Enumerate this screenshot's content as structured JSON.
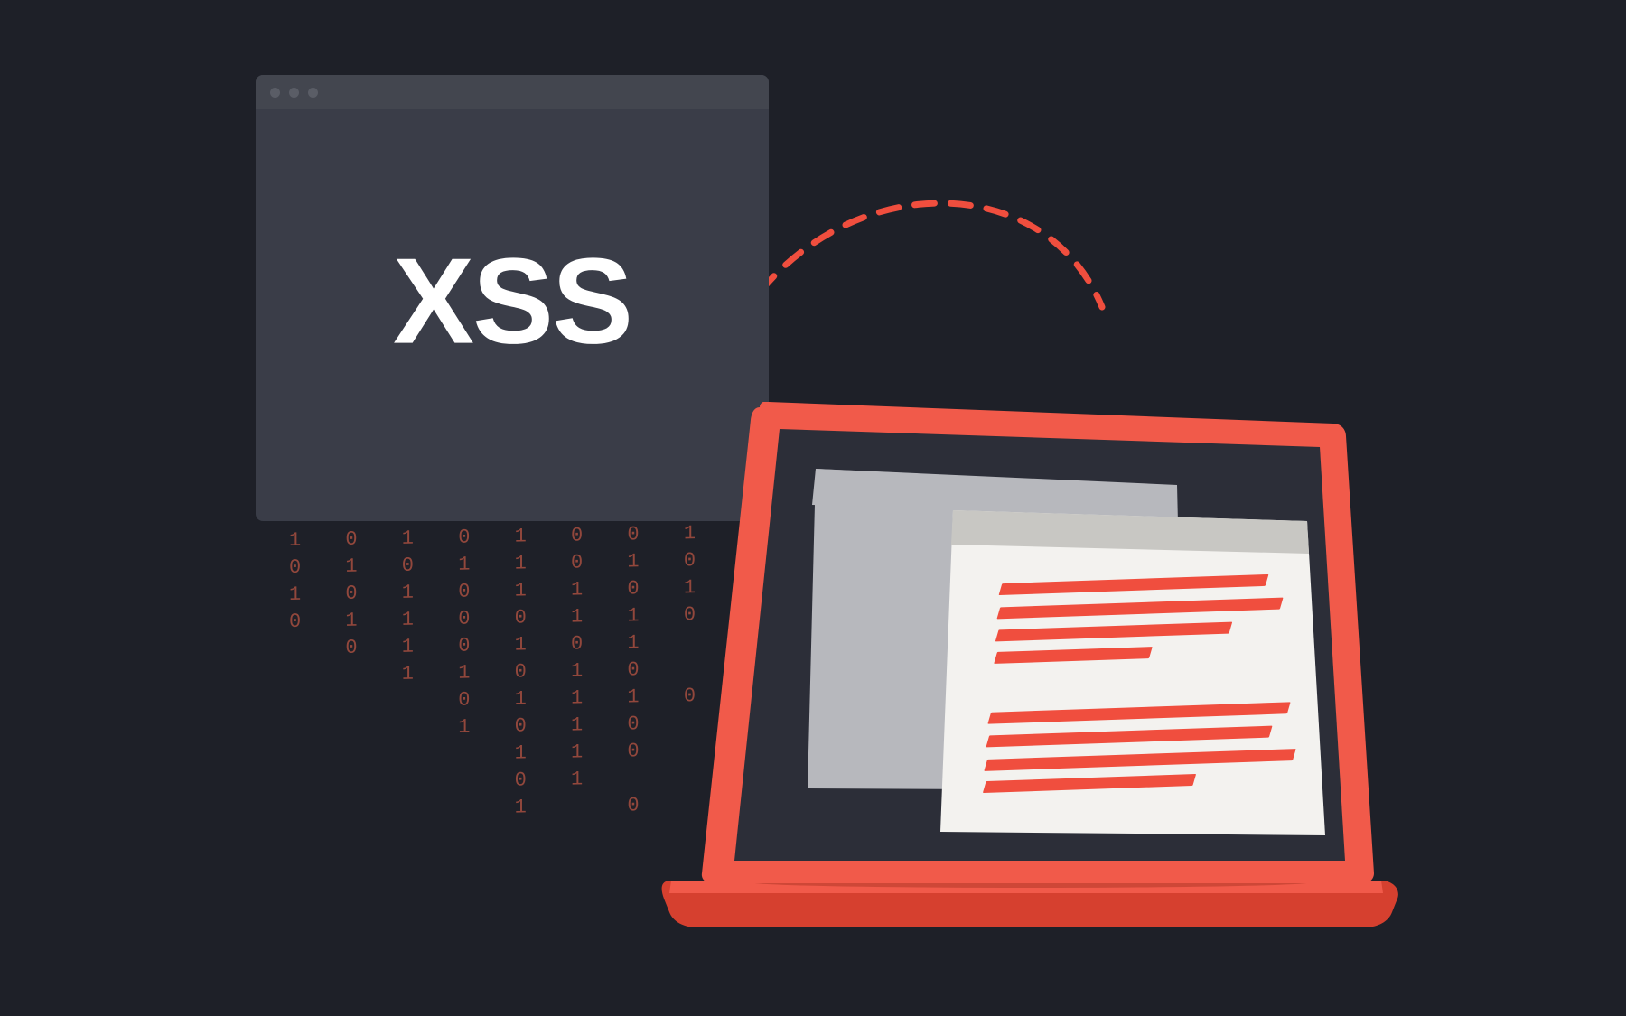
{
  "illustration": {
    "window_label": "XSS",
    "binary_rows": [
      "1 0 1 0 1 0 0 1 0",
      "0 1 0 1 1 0 1 0 1",
      "1 0 1 0 1 1 0 1 0",
      "0 1 1 0 0 1 1 0  ",
      "  0 1 0 1 0 1    ",
      "    1 1 0 1 0    ",
      "      0 1 1 1 0  ",
      "      1 0 1 0    ",
      "        1 1 0    ",
      "        0 1      ",
      "        1   0    "
    ],
    "colors": {
      "background": "#1e2028",
      "window_dark": "#3a3d48",
      "window_titlebar": "#43464f",
      "accent_red": "#f04e3e",
      "laptop_red": "#f15a4a",
      "laptop_red_dark": "#d6402f",
      "screen_dark": "#2c2e38",
      "doc_gray": "#b7b8bd",
      "doc_white": "#f3f2ef",
      "doc_titlebar": "#c8c7c3"
    }
  }
}
